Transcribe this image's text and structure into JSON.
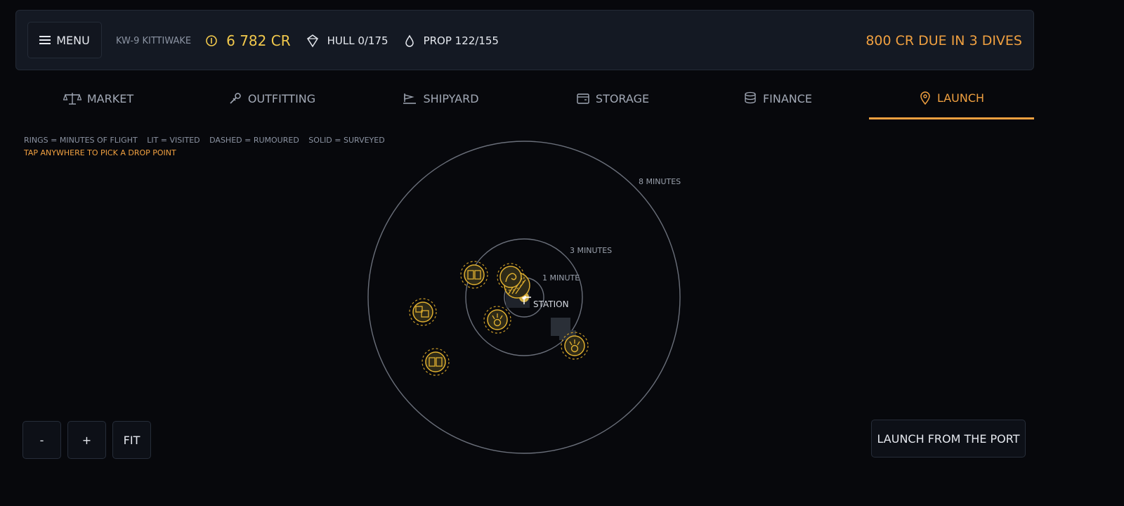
{
  "header": {
    "menu_label": "MENU",
    "ship_name": "KW-9 KITTIWAKE",
    "credits": "6 782 CR",
    "hull": "HULL 0/175",
    "prop": "PROP 122/155",
    "due": "800 CR DUE IN 3 DIVES"
  },
  "tabs": [
    {
      "label": "MARKET",
      "icon": "scales-icon"
    },
    {
      "label": "OUTFITTING",
      "icon": "wrench-icon"
    },
    {
      "label": "SHIPYARD",
      "icon": "ship-icon"
    },
    {
      "label": "STORAGE",
      "icon": "storage-icon"
    },
    {
      "label": "FINANCE",
      "icon": "coins-icon"
    },
    {
      "label": "LAUNCH",
      "icon": "map-pin-icon",
      "active": true
    }
  ],
  "legend": {
    "rings": "RINGS = MINUTES OF FLIGHT",
    "lit": "LIT = VISITED",
    "dashed": "DASHED = RUMOURED",
    "solid": "SOLID = SURVEYED",
    "hint": "TAP ANYWHERE TO PICK A DROP POINT"
  },
  "map": {
    "rings": [
      {
        "label": "8 MINUTES"
      },
      {
        "label": "3 MINUTES"
      },
      {
        "label": "1 MINUTE"
      }
    ],
    "station_label": "STATION"
  },
  "controls": {
    "zoom_out": "-",
    "zoom_in": "+",
    "fit": "FIT",
    "launch": "LAUNCH FROM THE PORT"
  },
  "colors": {
    "accent": "#f0a040",
    "credits": "#f2c94c",
    "marker": "#e0b030"
  }
}
